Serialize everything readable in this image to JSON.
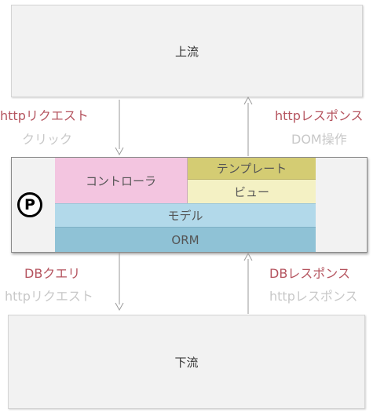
{
  "nodes": {
    "upstream": "上流",
    "downstream": "下流"
  },
  "framework": {
    "logo_letter": "P",
    "controller": "コントローラ",
    "template": "テンプレート",
    "view": "ビュー",
    "model": "モデル",
    "orm": "ORM"
  },
  "edges": {
    "top_down": {
      "label": "httpリクエスト",
      "sublabel": "クリック"
    },
    "top_up": {
      "label": "httpレスポンス",
      "sublabel": "DOM操作"
    },
    "bottom_down": {
      "label": "DBクエリ",
      "sublabel": "httpリクエスト"
    },
    "bottom_up": {
      "label": "DBレスポンス",
      "sublabel": "httpレスポンス"
    }
  },
  "colors": {
    "controller": "#f3c5e0",
    "template": "#d4cc73",
    "view": "#f4f1c4",
    "model": "#b2d9ea",
    "orm": "#8fc2d6",
    "label_primary": "#b5545f",
    "label_secondary": "#c8c8c8",
    "arrow": "#9a9a9a"
  }
}
